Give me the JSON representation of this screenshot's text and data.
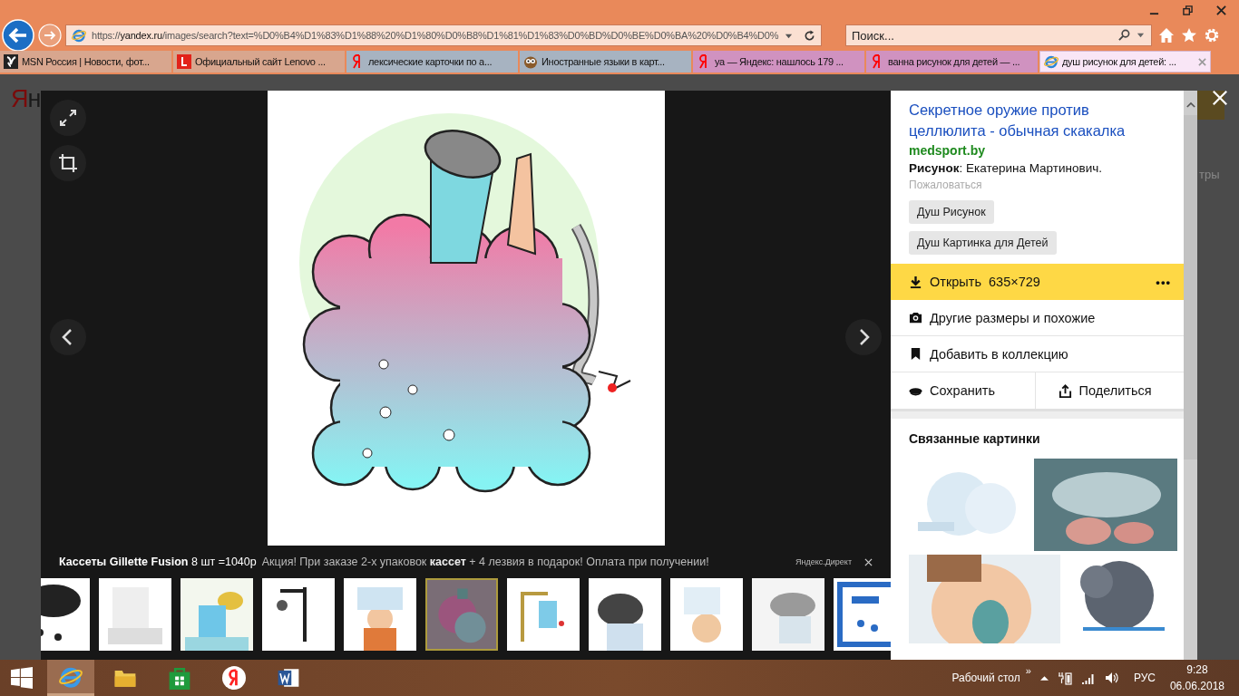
{
  "browser": {
    "url": {
      "scheme": "https://",
      "host": "yandex.ru",
      "path": "/images/search?text=%D0%B4%D1%83%D1%88%20%D1%80%D0%B8%D1%81%D1%83%D0%BD%D0%BE%D0%BA%20%D0%B4%D0%"
    },
    "search": {
      "placeholder": "Поиск..."
    }
  },
  "tabs": [
    {
      "label": "MSN Россия | Новости, фот...",
      "kind": "msn",
      "color": "#d8a68e",
      "selected": false
    },
    {
      "label": "Официальный сайт Lenovo ...",
      "kind": "lenovo",
      "color": "#d8a68e",
      "selected": false
    },
    {
      "label": "лексические карточки по а...",
      "kind": "yandex",
      "color": "#a7b3c1",
      "selected": false
    },
    {
      "label": "Иностранные языки в карт...",
      "kind": "owl",
      "color": "#a7b3c1",
      "selected": false
    },
    {
      "label": "уа — Яндекс: нашлось 179 ...",
      "kind": "yandex",
      "color": "#d092c0",
      "selected": false
    },
    {
      "label": "ванна рисунок для детей — ...",
      "kind": "yandex",
      "color": "#d092c0",
      "selected": false
    },
    {
      "label": "душ рисунок для детей: ...",
      "kind": "ie",
      "color": "#f9e6f6",
      "selected": true
    }
  ],
  "background": {
    "logo": [
      "Я",
      "н"
    ],
    "fragment": "тры"
  },
  "ad": {
    "title": "**Кассеты Gillette Fusion** 8 шт =1040р",
    "text": "Акция! При заказе 2-х упаковок **кассет** + 4 лезвия в подарок! Оплата при получении!",
    "source": "Яндекс.Директ"
  },
  "thumbnails": [
    {
      "selected": false
    },
    {
      "selected": false
    },
    {
      "selected": false
    },
    {
      "selected": false
    },
    {
      "selected": false
    },
    {
      "selected": true
    },
    {
      "selected": false
    },
    {
      "selected": false
    },
    {
      "selected": false
    },
    {
      "selected": false
    },
    {
      "selected": false
    }
  ],
  "panel": {
    "title": "Секретное оружие против целлюлита - обычная скакалка",
    "source": "medsport.by",
    "credit": "**Рисунок**: Екатерина Мартинович.",
    "report": "Пожаловаться",
    "tags": [
      "Душ Рисунок",
      "Душ Картинка для Детей"
    ],
    "open": {
      "label": "Открыть",
      "size": "635×729",
      "more": "•••"
    },
    "actions": [
      {
        "kind": "similar",
        "label": "Другие размеры и похожие"
      },
      {
        "kind": "collection",
        "label": "Добавить в коллекцию"
      }
    ],
    "split": [
      {
        "kind": "save",
        "label": "Сохранить"
      },
      {
        "kind": "share",
        "label": "Поделиться"
      }
    ],
    "related_title": "Связанные картинки"
  },
  "taskbar": {
    "apps": [
      {
        "kind": "ie",
        "selected": true
      },
      {
        "kind": "explorer",
        "selected": false
      },
      {
        "kind": "store",
        "selected": false
      },
      {
        "kind": "yandex",
        "selected": false
      },
      {
        "kind": "word",
        "selected": false
      }
    ],
    "desktop": "Рабочий стол",
    "overflow": "»",
    "language": "РУС",
    "time": "9:28",
    "date": "06.06.2018"
  }
}
